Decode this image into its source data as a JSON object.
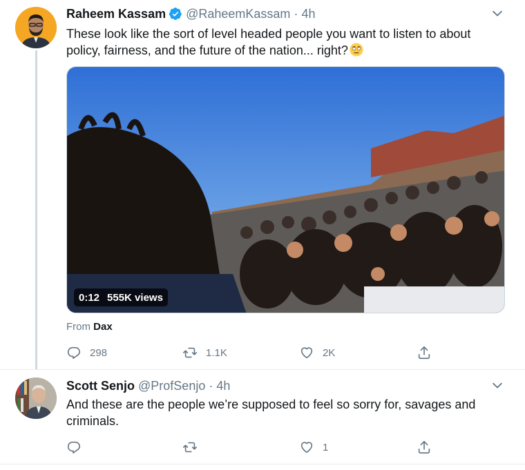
{
  "tweets": [
    {
      "name": "Raheem Kassam",
      "handle": "@RaheemKassam",
      "dot": "·",
      "time": "4h",
      "text": "These look like the sort of level headed people you want to listen to about policy, fairness, and the future of the nation... right?",
      "emoji_icon": "face-with-rolling-eyes-icon",
      "media": {
        "duration": "0:12",
        "views": "555K views",
        "progress_icon": "video-thumbnail"
      },
      "from_label": "From",
      "from_source": "Dax",
      "replies": "298",
      "retweets": "1.1K",
      "likes": "2K"
    },
    {
      "name": "Scott Senjo",
      "handle": "@ProfSenjo",
      "dot": "·",
      "time": "4h",
      "text": "And these are the people we’re supposed to feel so sorry for, savages and criminals.",
      "replies": "",
      "retweets": "",
      "likes": "1"
    }
  ],
  "colors": {
    "verified": "#1da1f2",
    "secondary_text": "#657786",
    "avatar_bg_1": "#f5a623",
    "divider": "#e6ecf0"
  }
}
